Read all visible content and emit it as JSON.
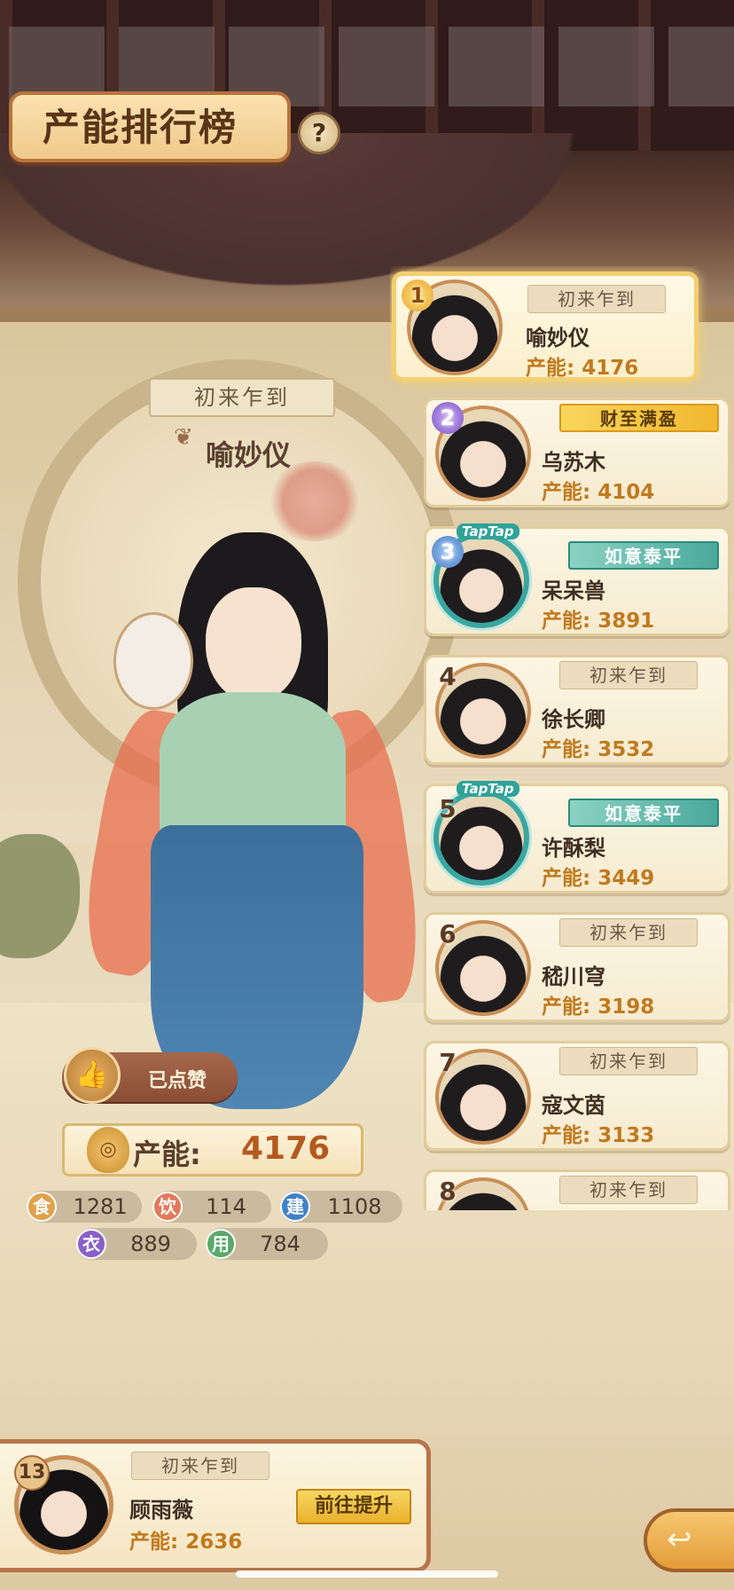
{
  "header": {
    "title": "产能排行榜",
    "help_glyph": "?"
  },
  "character": {
    "title": "初来乍到",
    "name": "喻妙仪"
  },
  "like": {
    "label": "已点赞",
    "icon": "thumbs-up-icon"
  },
  "capacity": {
    "label": "产能:",
    "value": "4176"
  },
  "stats": [
    {
      "glyph": "食",
      "value": "1281",
      "color": "#e0a24a"
    },
    {
      "glyph": "饮",
      "value": "114",
      "color": "#e07a5a"
    },
    {
      "glyph": "建",
      "value": "1108",
      "color": "#3f82c8"
    },
    {
      "glyph": "衣",
      "value": "889",
      "color": "#8a60c8"
    },
    {
      "glyph": "用",
      "value": "784",
      "color": "#5aa86a"
    }
  ],
  "ranking": [
    {
      "rank": "1",
      "name": "喻妙仪",
      "capacity": "产能: 4176",
      "title": "初来乍到",
      "style": "plain",
      "taptap": false
    },
    {
      "rank": "2",
      "name": "乌苏木",
      "capacity": "产能: 4104",
      "title": "财至满盈",
      "style": "gold",
      "taptap": false
    },
    {
      "rank": "3",
      "name": "呆呆兽",
      "capacity": "产能: 3891",
      "title": "如意泰平",
      "style": "teal",
      "taptap": true
    },
    {
      "rank": "4",
      "name": "徐长卿",
      "capacity": "产能: 3532",
      "title": "初来乍到",
      "style": "plain",
      "taptap": false
    },
    {
      "rank": "5",
      "name": "许酥梨",
      "capacity": "产能: 3449",
      "title": "如意泰平",
      "style": "teal",
      "taptap": true
    },
    {
      "rank": "6",
      "name": "嵇川穹",
      "capacity": "产能: 3198",
      "title": "初来乍到",
      "style": "plain",
      "taptap": false
    },
    {
      "rank": "7",
      "name": "寇文茵",
      "capacity": "产能: 3133",
      "title": "初来乍到",
      "style": "plain",
      "taptap": false
    },
    {
      "rank": "8",
      "name": "",
      "capacity": "",
      "title": "初来乍到",
      "style": "plain",
      "taptap": false
    }
  ],
  "taptap_label": "TapTap",
  "self": {
    "rank": "13",
    "title": "初来乍到",
    "name": "顾雨薇",
    "capacity": "产能: 2636",
    "improve_label": "前往提升"
  },
  "back_icon": "back-arrow-icon"
}
